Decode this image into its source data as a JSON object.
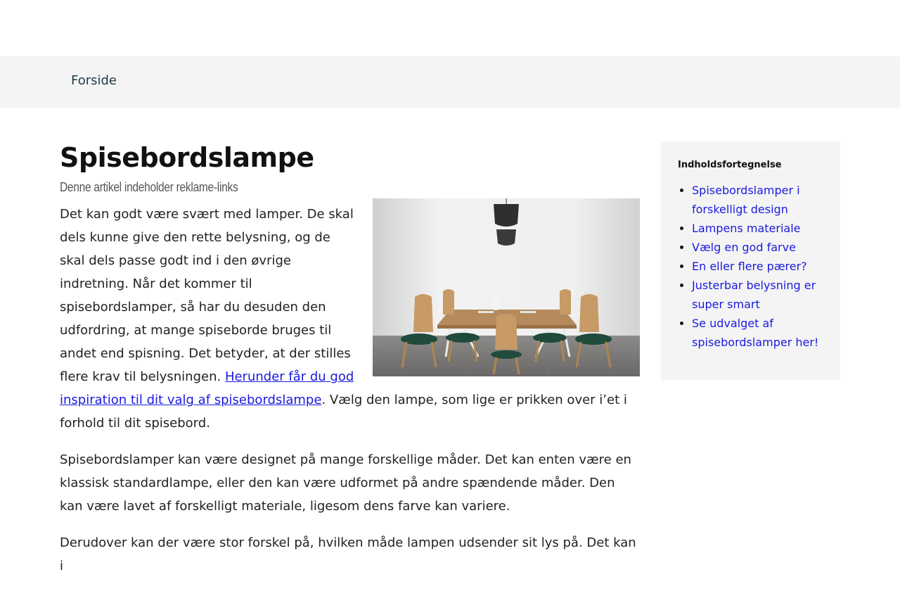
{
  "nav": {
    "home_label": "Forside"
  },
  "article": {
    "title": "Spisebordslampe",
    "ad_notice": "Denne artikel indeholder reklame-links",
    "image_alt": "Spisebord med stole og to pendellamper",
    "paragraph1": {
      "text_before": "Det kan godt være svært med lamper. De skal dels kunne give den rette belysning, og de skal dels passe godt ind i den øvrige indretning. Når det kommer til spisebordslamper, så har du desuden den udfordring, at mange spiseborde bruges til andet end spisning. Det betyder, at der stilles flere krav til belysningen. ",
      "link_text": "Herunder får du god inspiration til dit valg af spisebordslampe",
      "text_after": ". Vælg den lampe, som lige er prikken over i’et i forhold til dit spisebord."
    },
    "paragraph2": "Spisebordslamper kan være designet på mange forskellige måder. Det kan enten være en klassisk standardlampe, eller den kan være udformet på andre spændende måder. Den kan være lavet af forskelligt materiale, ligesom dens farve kan variere.",
    "paragraph3": "Derudover kan der være stor forskel på, hvilken måde lampen udsender sit lys på. Det kan i"
  },
  "toc": {
    "title": "Indholdsfortegnelse",
    "items": [
      "Spisebordslamper i forskelligt design",
      "Lampens materiale",
      "Vælg en god farve",
      "En eller flere pærer?",
      "Justerbar belysning er super smart",
      "Se udvalget af spisebordslamper her!"
    ]
  },
  "colors": {
    "link": "#1a1ae0",
    "nav_background": "#f4f4f4",
    "nav_text": "#1c3a4a"
  }
}
